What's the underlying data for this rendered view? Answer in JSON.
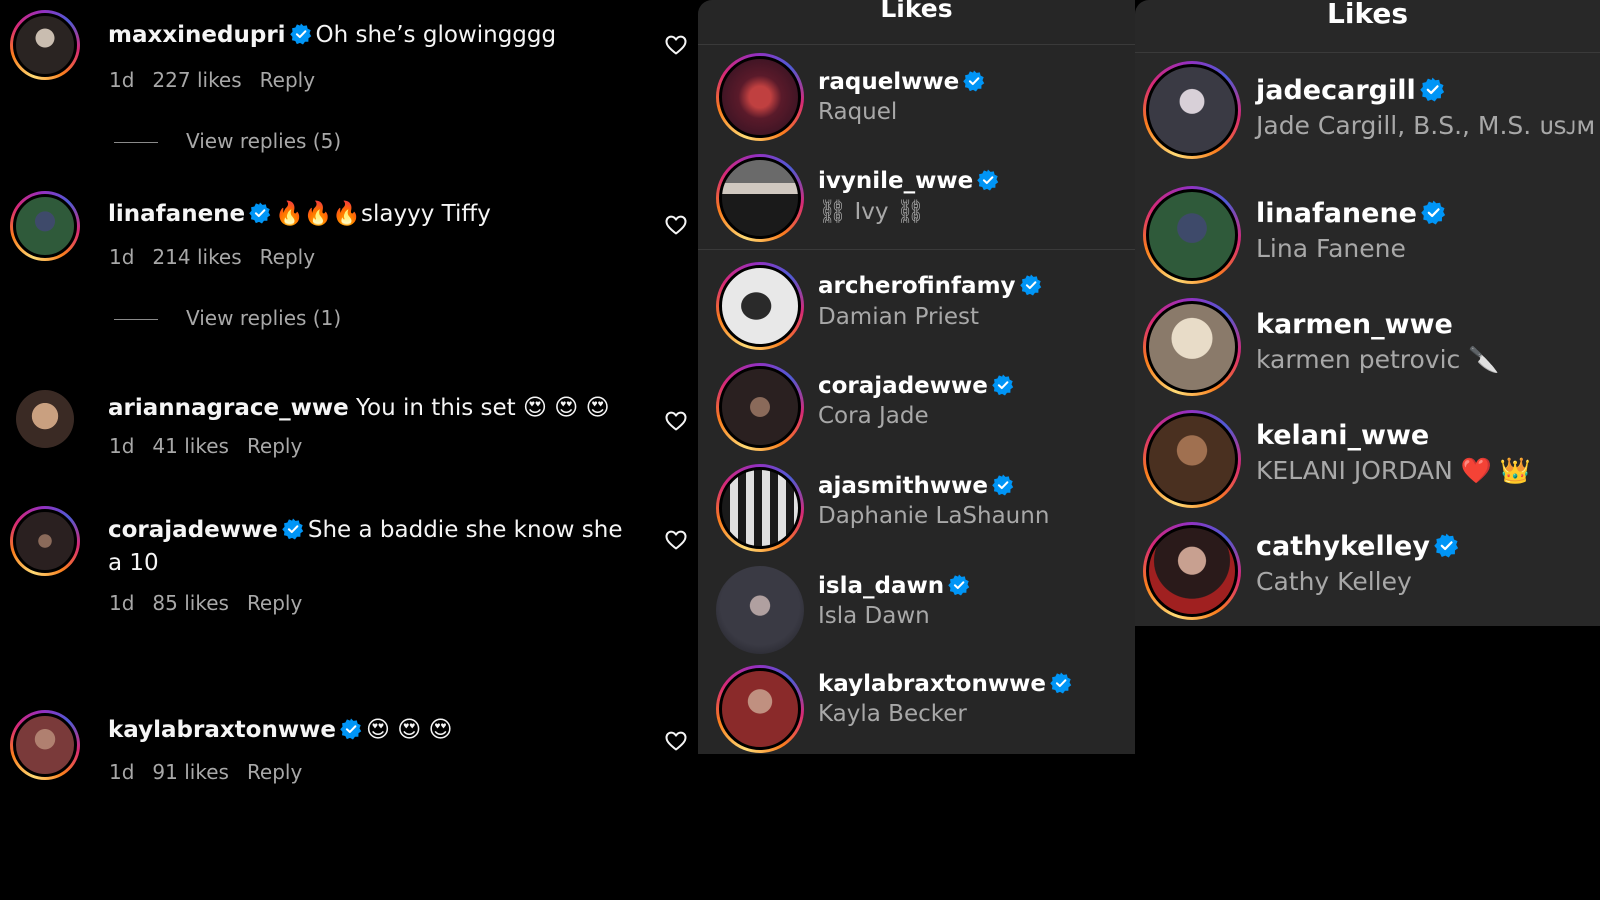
{
  "comments": [
    {
      "username": "maxxinedupri",
      "verified": true,
      "text": "Oh she’s glowingggg",
      "age": "1d",
      "likes": "227 likes",
      "reply": "Reply",
      "view_replies": "View replies (5)",
      "avatar_color": "#6b6560"
    },
    {
      "username": "linafanene",
      "verified": true,
      "text": "🔥🔥🔥slayyy Tiffy",
      "age": "1d",
      "likes": "214 likes",
      "reply": "Reply",
      "view_replies": "View replies (1)",
      "avatar_color": "#2f5a3a"
    },
    {
      "username": "ariannagrace_wwe",
      "verified": false,
      "text": "You in this set 😍 😍 😍",
      "age": "1d",
      "likes": "41 likes",
      "reply": "Reply",
      "avatar_color": "#8a6a55"
    },
    {
      "username": "corajadewwe",
      "verified": true,
      "text": "She a baddie she know she a 10",
      "age": "1d",
      "likes": "85 likes",
      "reply": "Reply",
      "avatar_color": "#3a2a2a"
    },
    {
      "username": "kaylabraxtonwwe",
      "verified": true,
      "text": "😍 😍 😍",
      "age": "1d",
      "likes": "91 likes",
      "reply": "Reply",
      "avatar_color": "#7a3a3a"
    }
  ],
  "likes_panel_1": {
    "title": "Likes",
    "users": [
      {
        "username": "raquelwwe",
        "name": "Raquel",
        "verified": true,
        "avatar_color": "#7a2a2a"
      },
      {
        "username": "ivynile_wwe",
        "name": "⛓ Ivy ⛓",
        "verified": true,
        "avatar_color": "#4a4a4a"
      },
      {
        "username": "archerofinfamy",
        "name": "Damian Priest",
        "verified": true,
        "avatar_color": "#d8d8d8"
      },
      {
        "username": "corajadewwe",
        "name": "Cora Jade",
        "verified": true,
        "avatar_color": "#3a2a2a"
      },
      {
        "username": "ajasmithwwe",
        "name": "Daphanie LaShaunn",
        "verified": true,
        "avatar_color": "#5a4a3a"
      },
      {
        "username": "isla_dawn",
        "name": "Isla Dawn",
        "verified": true,
        "avatar_color": "#2a2a30"
      },
      {
        "username": "kaylabraxtonwwe",
        "name": "Kayla Becker",
        "verified": true,
        "avatar_color": "#8a3a3a"
      }
    ]
  },
  "likes_panel_2": {
    "title": "Likes",
    "users": [
      {
        "username": "jadecargill",
        "name": "Jade Cargill, B.S., M.S. ᴜꜱᴊᴍ",
        "verified": true,
        "avatar_color": "#3a3a40"
      },
      {
        "username": "linafanene",
        "name": "Lina Fanene",
        "verified": true,
        "avatar_color": "#2f5a3a"
      },
      {
        "username": "karmen_wwe",
        "name": "karmen petrovic 🔪",
        "verified": false,
        "avatar_color": "#c8b8a8"
      },
      {
        "username": "kelani_wwe",
        "name": "KELANI JORDAN ❤️ 👑",
        "verified": false,
        "avatar_color": "#5a3a2a"
      },
      {
        "username": "cathykelley",
        "name": "Cathy Kelley",
        "verified": true,
        "avatar_color": "#8a2a2a"
      }
    ]
  },
  "colors": {
    "background": "#000000",
    "panel": "#262626",
    "verified": "#0095f6",
    "secondary_text": "#a8a8a8"
  }
}
